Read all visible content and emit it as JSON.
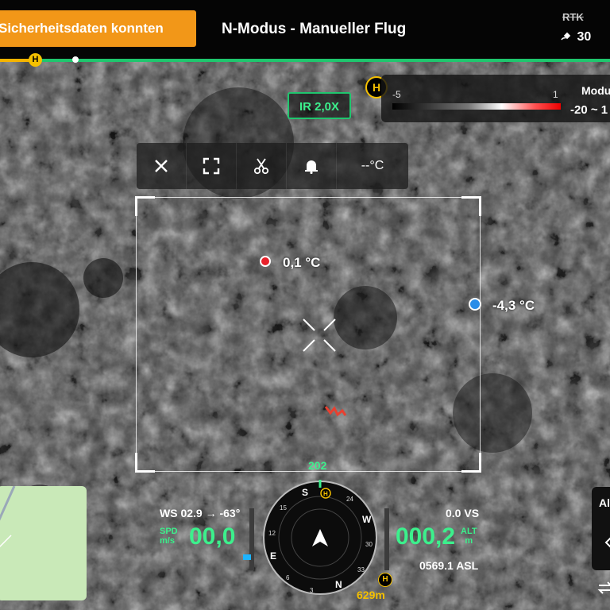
{
  "header": {
    "warning_text": "Sicherheitsdaten konnten",
    "flight_mode": "N-Modus - Manueller Flug",
    "rtk_label": "RTK",
    "satellite_count": "30",
    "satellite_icon": "satellite-icon"
  },
  "progress": {
    "home_marker": "H",
    "completed_fraction": 1.0
  },
  "camera": {
    "home_marker": "H",
    "zoom_label": "IR 2,0X",
    "palette_min": "-5",
    "palette_max": "1",
    "palette_mode_label": "Modu",
    "palette_range": "-20 ~ 1"
  },
  "toolbar": {
    "close_icon": "close-icon",
    "fullscreen_icon": "fullscreen-icon",
    "cut_icon": "scissors-icon",
    "alarm_icon": "bell-icon",
    "temperature_readout": "--°C"
  },
  "measurement": {
    "hot_spot_temp": "0,1 °C",
    "cold_spot_temp": "-4,3 °C",
    "hot_color": "#e8202a",
    "cold_color": "#2a8de8"
  },
  "telemetry": {
    "heading": "202",
    "wind": "WS 02.9 → -63°",
    "speed_label_top": "SPD",
    "speed_label_bottom": "m/s",
    "speed_value": "00,0",
    "vertical_speed": "0.0 VS",
    "altitude_value": "000,2",
    "altitude_label_top": "ALT",
    "altitude_label_bottom": "m",
    "altitude_asl": "0569.1 ASL",
    "home_marker": "H",
    "home_distance": "629m",
    "accent_color": "#3cf08c"
  },
  "compass": {
    "labels": [
      "N",
      "E",
      "S",
      "W"
    ],
    "ticks": [
      "33",
      "30",
      "24",
      "21",
      "15",
      "12",
      "6",
      "3"
    ]
  },
  "right_panel": {
    "label": "Al",
    "swap_icon": "swap-arrows-icon"
  }
}
